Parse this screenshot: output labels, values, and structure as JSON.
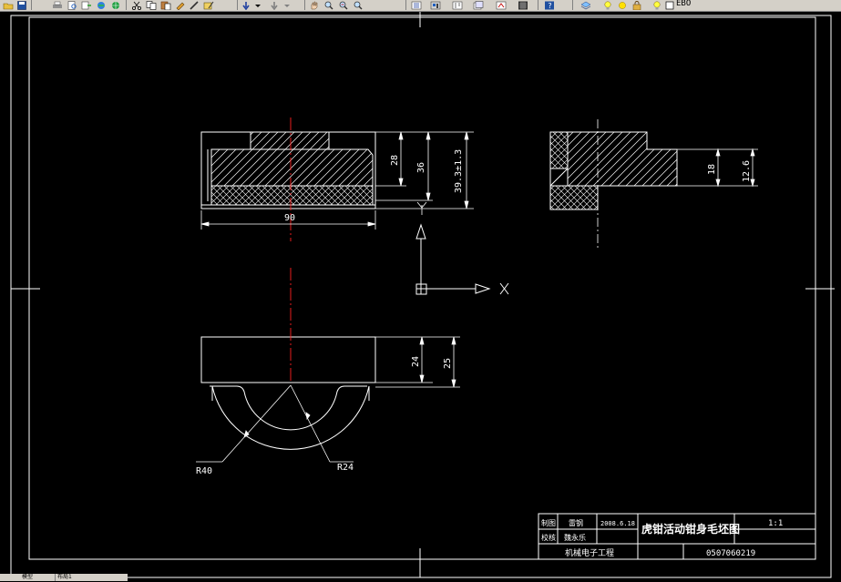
{
  "toolbar": {
    "buttons": [
      "folder-open-icon",
      "save-icon",
      "print-icon",
      "preview-icon",
      "publish-icon",
      "plot-icon",
      "cut-icon",
      "copy-icon",
      "paste-icon",
      "match-properties-icon",
      "undo-icon",
      "redo-icon",
      "pan-icon",
      "zoom-realtime-icon",
      "zoom-window-icon",
      "zoom-previous-icon",
      "properties-icon",
      "design-center-icon",
      "tool-palettes-icon",
      "sheet-set-icon",
      "markup-icon",
      "calculator-icon",
      "help-icon",
      "layer-manager-icon",
      "lightbulb-icon",
      "sun-icon",
      "lock-icon",
      "color-swatch-icon"
    ],
    "layer_name": "EBO"
  },
  "drawing": {
    "dims": {
      "d28": "28",
      "d36": "36",
      "d393": "39.3±1.3",
      "d90": "90",
      "d18": "18",
      "d126": "12.6",
      "d24": "24",
      "d25": "25",
      "r40": "R40",
      "r24": "R24"
    },
    "ucs": {
      "x_label": "X"
    },
    "title_block": {
      "title": "虎钳活动钳身毛坯图",
      "scale": "1:1",
      "row1_label": "制图",
      "row1_name": "雷钢",
      "row1_date": "2008.6.18",
      "row2_label": "校核",
      "row2_name": "魏永乐",
      "department": "机械电子工程",
      "student_no": "0507060219"
    }
  },
  "status_tabs": [
    "模型",
    "布局1"
  ],
  "colors": {
    "background": "#000000",
    "line": "#ffffff",
    "centerline": "#ff2020",
    "toolbar": "#d4d0c8"
  }
}
